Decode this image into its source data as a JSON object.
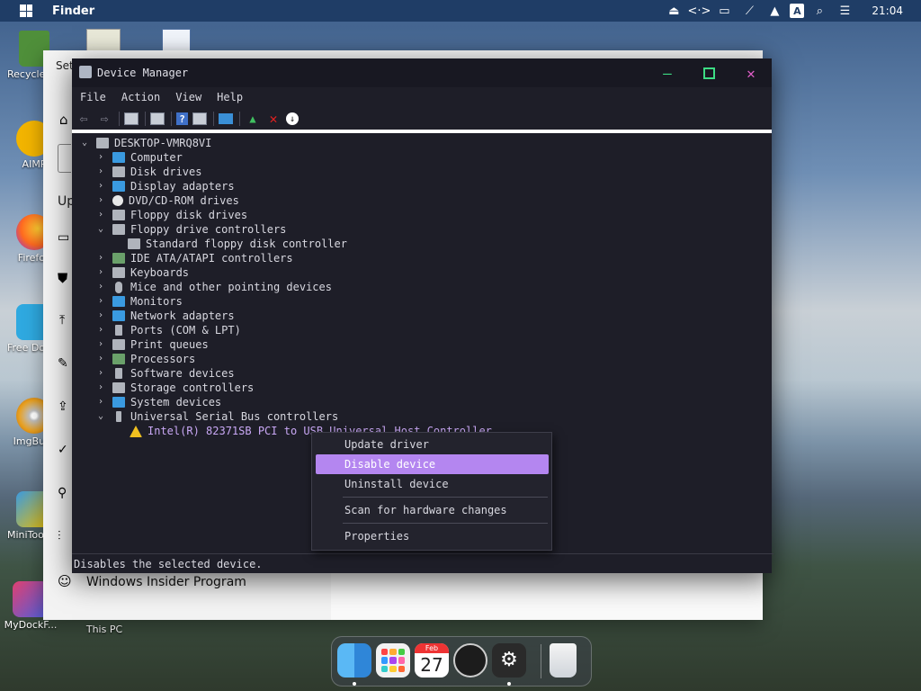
{
  "menubar": {
    "app_name": "Finder",
    "clock": "21:04",
    "letter_icon": "A",
    "tray_icons": [
      "eject-icon",
      "code-icon",
      "monitor-icon",
      "network-off-icon",
      "up-arrow-icon",
      "letter-a-icon",
      "search-icon",
      "toggle-icon"
    ]
  },
  "desktop": {
    "icons": [
      {
        "label": "Recycle Bin",
        "icon": "recycle-bin-icon"
      },
      {
        "label": "AIMP",
        "icon": "aimp-icon"
      },
      {
        "label": "Firefox",
        "icon": "firefox-icon"
      },
      {
        "label": "Free Download",
        "icon": "download-manager-icon"
      },
      {
        "label": "ImgBurn",
        "icon": "imgburn-icon"
      },
      {
        "label": "MiniTool Partition",
        "icon": "minitool-icon"
      },
      {
        "label": "MyDockF...",
        "icon": "mydock-icon"
      },
      {
        "label": "This PC",
        "icon": "this-pc-icon"
      }
    ]
  },
  "settings": {
    "title": "Set",
    "side_text": "Up",
    "bottom_item": "Windows Insider Program"
  },
  "device_manager": {
    "title": "Device Manager",
    "menu": [
      "File",
      "Action",
      "View",
      "Help"
    ],
    "root": "DESKTOP-VMRQ8VI",
    "tree": [
      {
        "label": "Computer",
        "expanded": false,
        "level": 1
      },
      {
        "label": "Disk drives",
        "expanded": false,
        "level": 1
      },
      {
        "label": "Display adapters",
        "expanded": false,
        "level": 1
      },
      {
        "label": "DVD/CD-ROM drives",
        "expanded": false,
        "level": 1
      },
      {
        "label": "Floppy disk drives",
        "expanded": false,
        "level": 1
      },
      {
        "label": "Floppy drive controllers",
        "expanded": true,
        "level": 1
      },
      {
        "label": "Standard floppy disk controller",
        "level": 2
      },
      {
        "label": "IDE ATA/ATAPI controllers",
        "expanded": false,
        "level": 1
      },
      {
        "label": "Keyboards",
        "expanded": false,
        "level": 1
      },
      {
        "label": "Mice and other pointing devices",
        "expanded": false,
        "level": 1
      },
      {
        "label": "Monitors",
        "expanded": false,
        "level": 1
      },
      {
        "label": "Network adapters",
        "expanded": false,
        "level": 1
      },
      {
        "label": "Ports (COM & LPT)",
        "expanded": false,
        "level": 1
      },
      {
        "label": "Print queues",
        "expanded": false,
        "level": 1
      },
      {
        "label": "Processors",
        "expanded": false,
        "level": 1
      },
      {
        "label": "Software devices",
        "expanded": false,
        "level": 1
      },
      {
        "label": "Storage controllers",
        "expanded": false,
        "level": 1
      },
      {
        "label": "System devices",
        "expanded": false,
        "level": 1
      },
      {
        "label": "Universal Serial Bus controllers",
        "expanded": true,
        "level": 1
      },
      {
        "label": "Intel(R) 82371SB PCI to USB Universal Host Controller",
        "level": 2,
        "warning": true
      }
    ],
    "status": "Disables the selected device."
  },
  "context_menu": {
    "items": [
      "Update driver",
      "Disable device",
      "Uninstall device",
      "Scan for hardware changes",
      "Properties"
    ],
    "highlighted": "Disable device"
  },
  "dock": {
    "calendar_month": "Feb",
    "calendar_day": "27",
    "apps": [
      "finder-icon",
      "launchpad-icon",
      "calendar-icon",
      "clock-icon",
      "settings-icon",
      "trash-icon"
    ]
  }
}
